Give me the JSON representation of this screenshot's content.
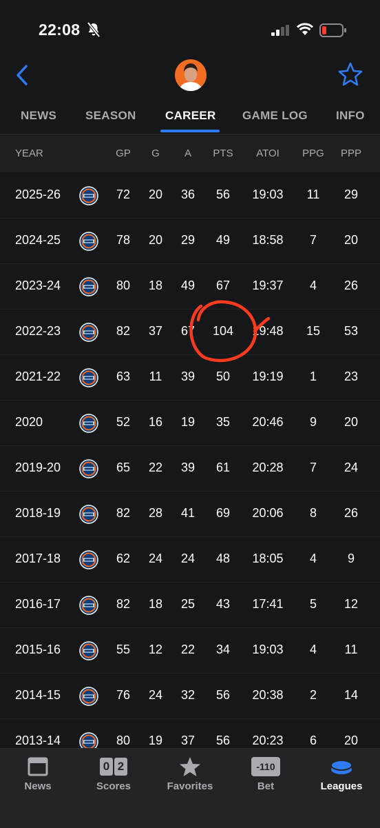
{
  "status_bar": {
    "time": "22:08"
  },
  "tabs": [
    {
      "label": "NEWS"
    },
    {
      "label": "SEASON"
    },
    {
      "label": "CAREER",
      "active": true
    },
    {
      "label": "GAME LOG"
    },
    {
      "label": "INFO"
    }
  ],
  "table": {
    "headers": [
      "YEAR",
      "GP",
      "G",
      "A",
      "PTS",
      "ATOI",
      "PPG",
      "PPP"
    ],
    "rows": [
      {
        "year": "2025-26",
        "gp": "72",
        "g": "20",
        "a": "36",
        "pts": "56",
        "atoi": "19:03",
        "ppg": "11",
        "ppp": "29"
      },
      {
        "year": "2024-25",
        "gp": "78",
        "g": "20",
        "a": "29",
        "pts": "49",
        "atoi": "18:58",
        "ppg": "7",
        "ppp": "20"
      },
      {
        "year": "2023-24",
        "gp": "80",
        "g": "18",
        "a": "49",
        "pts": "67",
        "atoi": "19:37",
        "ppg": "4",
        "ppp": "26"
      },
      {
        "year": "2022-23",
        "gp": "82",
        "g": "37",
        "a": "67",
        "pts": "104",
        "atoi": "19:48",
        "ppg": "15",
        "ppp": "53"
      },
      {
        "year": "2021-22",
        "gp": "63",
        "g": "11",
        "a": "39",
        "pts": "50",
        "atoi": "19:19",
        "ppg": "1",
        "ppp": "23"
      },
      {
        "year": "2020",
        "gp": "52",
        "g": "16",
        "a": "19",
        "pts": "35",
        "atoi": "20:46",
        "ppg": "9",
        "ppp": "20"
      },
      {
        "year": "2019-20",
        "gp": "65",
        "g": "22",
        "a": "39",
        "pts": "61",
        "atoi": "20:28",
        "ppg": "7",
        "ppp": "24"
      },
      {
        "year": "2018-19",
        "gp": "82",
        "g": "28",
        "a": "41",
        "pts": "69",
        "atoi": "20:06",
        "ppg": "8",
        "ppp": "26"
      },
      {
        "year": "2017-18",
        "gp": "62",
        "g": "24",
        "a": "24",
        "pts": "48",
        "atoi": "18:05",
        "ppg": "4",
        "ppp": "9"
      },
      {
        "year": "2016-17",
        "gp": "82",
        "g": "18",
        "a": "25",
        "pts": "43",
        "atoi": "17:41",
        "ppg": "5",
        "ppp": "12"
      },
      {
        "year": "2015-16",
        "gp": "55",
        "g": "12",
        "a": "22",
        "pts": "34",
        "atoi": "19:03",
        "ppg": "4",
        "ppp": "11"
      },
      {
        "year": "2014-15",
        "gp": "76",
        "g": "24",
        "a": "32",
        "pts": "56",
        "atoi": "20:38",
        "ppg": "2",
        "ppp": "14"
      },
      {
        "year": "2013-14",
        "gp": "80",
        "g": "19",
        "a": "37",
        "pts": "56",
        "atoi": "20:23",
        "ppg": "6",
        "ppp": "20"
      }
    ]
  },
  "bottom_nav": [
    {
      "label": "News",
      "icon": "news-icon"
    },
    {
      "label": "Scores",
      "icon": "scores-icon",
      "digits": [
        "0",
        "2"
      ]
    },
    {
      "label": "Favorites",
      "icon": "star-icon"
    },
    {
      "label": "Bet",
      "icon": "bet-icon",
      "badge": "-110"
    },
    {
      "label": "Leagues",
      "icon": "leagues-icon",
      "active": true
    }
  ],
  "colors": {
    "accent": "#2f7bf5",
    "background": "#161718",
    "annotation": "#ff3b1f",
    "battery_low": "#ff3b30"
  }
}
